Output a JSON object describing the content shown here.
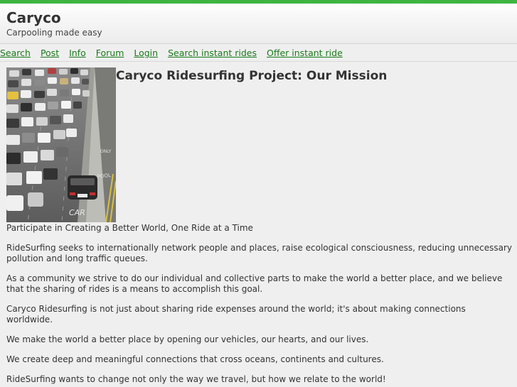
{
  "site": {
    "title": "Caryco",
    "tagline": "Carpooling made easy"
  },
  "nav": {
    "items": [
      {
        "id": "search",
        "label": "Search"
      },
      {
        "id": "post",
        "label": "Post"
      },
      {
        "id": "info",
        "label": "Info"
      },
      {
        "id": "forum",
        "label": "Forum"
      },
      {
        "id": "login",
        "label": "Login"
      },
      {
        "id": "search-instant",
        "label": "Search instant rides"
      },
      {
        "id": "offer-instant",
        "label": "Offer instant ride"
      }
    ]
  },
  "main": {
    "heading": "Caryco Ridesurfing Project: Our Mission",
    "image_icon": "traffic-photo",
    "lead": "Participate in Creating a Better World, One Ride at a Time",
    "paragraphs": [
      "RideSurfing seeks to internationally network people and places, raise ecological consciousness, reducing unnecessary pollution and long traffic queues.",
      "As a community we strive to do our individual and collective parts to make the world a better place, and we believe that the sharing of rides is a means to accomplish this goal.",
      "Caryco Ridesurfing is not just about sharing ride expenses around the world; it's about making connections worldwide.",
      "We make the world a better place by opening our vehicles, our hearts, and our lives.",
      "We create deep and meaningful connections that cross oceans, continents and cultures.",
      "RideSurfing wants to change not only the way we travel, but how we relate to the world!"
    ]
  },
  "colors": {
    "top_bar": "#3fb43f",
    "link": "#1a7a1a",
    "background": "#efefef",
    "text": "#333333"
  }
}
